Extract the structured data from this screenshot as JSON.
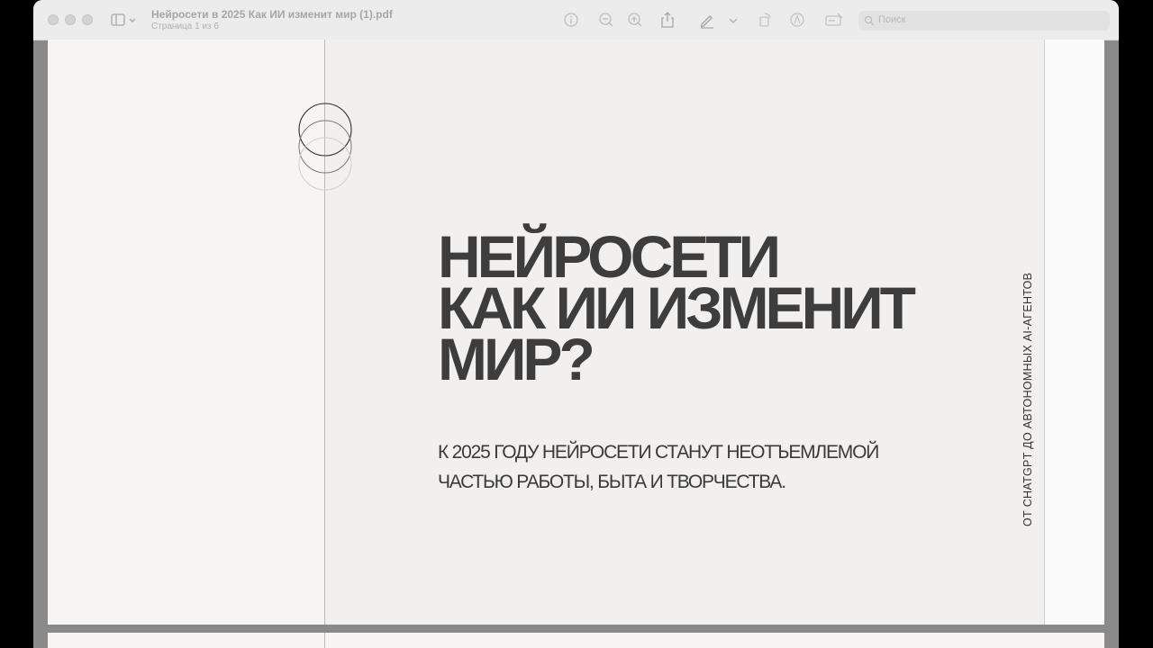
{
  "window": {
    "title": "Нейросети в 2025 Как ИИ изменит мир (1).pdf",
    "subtitle": "Страница 1 из 6"
  },
  "toolbar": {
    "icons": [
      "info-icon",
      "zoom-out-icon",
      "zoom-in-icon",
      "share-icon",
      "markup-pen-icon",
      "chevron-down-icon",
      "rotate-icon",
      "highlight-icon",
      "form-fill-icon"
    ],
    "search_placeholder": "Поиск"
  },
  "pdf_page": {
    "headline_lines": [
      "НЕЙРОСЕТИ",
      "КАК ИИ ИЗМЕНИТ",
      "МИР?"
    ],
    "subtext_lines": [
      "К 2025 ГОДУ НЕЙРОСЕТИ СТАНУТ НЕОТЪЕМЛЕМОЙ",
      "ЧАСТЬЮ РАБОТЫ, БЫТА И ТВОРЧЕСТВА."
    ],
    "side_caption": "ОТ CHATGPT ДО АВТОНОМНЫХ AI-АГЕНТОВ"
  },
  "colors": {
    "page_bg": "#f1f0ee",
    "headline": "#3d3d3d",
    "toolbar_bg": "#ececec"
  }
}
